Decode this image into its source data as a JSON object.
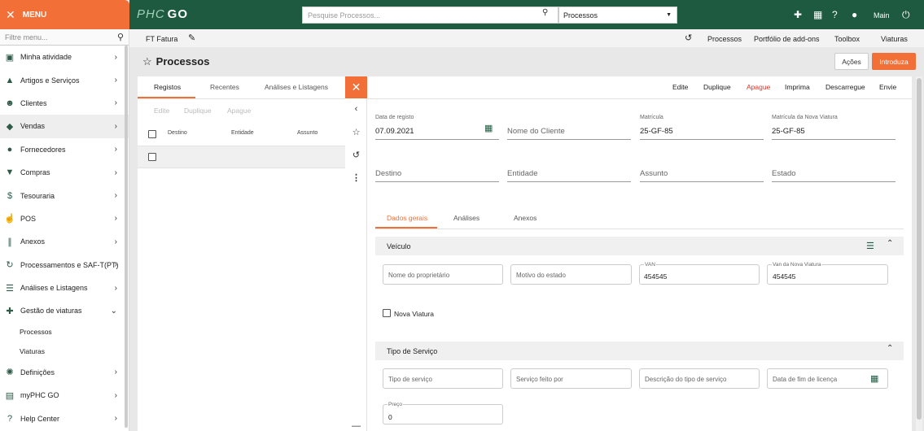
{
  "menu": {
    "title": "MENU",
    "filter_placeholder": "Filtre menu...",
    "items": [
      {
        "label": "Minha atividade",
        "icon": "person-board-icon"
      },
      {
        "label": "Artigos e Serviços",
        "icon": "shapes-icon"
      },
      {
        "label": "Clientes",
        "icon": "people-icon"
      },
      {
        "label": "Vendas",
        "icon": "tag-icon"
      },
      {
        "label": "Fornecedores",
        "icon": "person-icon"
      },
      {
        "label": "Compras",
        "icon": "basket-icon"
      },
      {
        "label": "Tesouraria",
        "icon": "dollar-icon"
      },
      {
        "label": "POS",
        "icon": "touch-icon"
      },
      {
        "label": "Anexos",
        "icon": "paperclip-icon"
      },
      {
        "label": "Processamentos e SAF-T(PT)",
        "icon": "sync-icon"
      },
      {
        "label": "Análises e Listagens",
        "icon": "list-icon"
      },
      {
        "label": "Gestão de viaturas",
        "icon": "puzzle-icon"
      }
    ],
    "subitems": [
      "Processos",
      "Viaturas"
    ],
    "items_after": [
      {
        "label": "Definições",
        "icon": "gear-icon"
      },
      {
        "label": "myPHC GO",
        "icon": "document-icon"
      },
      {
        "label": "Help Center",
        "icon": "help-icon"
      }
    ]
  },
  "topbar": {
    "logo_left": "PHC",
    "logo_right": "GO",
    "search_placeholder": "Pesquise Processos...",
    "search_scope": "Processos",
    "user_label": "Main"
  },
  "secbar": {
    "left_label": "FT Fatura",
    "links": [
      "Processos",
      "Portfólio de add-ons",
      "Toolbox",
      "Viaturas"
    ]
  },
  "page": {
    "title": "Processos",
    "btn_actions": "Ações",
    "btn_introduce": "Introduza"
  },
  "list": {
    "tabs": [
      "Registos",
      "Recentes",
      "Análises e Listagens"
    ],
    "actions": [
      "Edite",
      "Duplique",
      "Apague"
    ],
    "columns": [
      "Destino",
      "Entidade",
      "Assunto"
    ]
  },
  "form": {
    "actions": [
      "Edite",
      "Duplique",
      "Apague",
      "Imprima",
      "Descarregue",
      "Envie"
    ],
    "fields_row1": [
      {
        "label": "Data de registo",
        "value": "07.09.2021"
      },
      {
        "label": "",
        "value": "Nome do Cliente"
      },
      {
        "label": "Matrícula",
        "value": "25-GF-85"
      },
      {
        "label": "Matrícula da Nova Viatura",
        "value": "25-GF-85"
      }
    ],
    "fields_row2": [
      "Destino",
      "Entidade",
      "Assunto",
      "Estado"
    ],
    "tabs": [
      "Dados gerais",
      "Análises",
      "Anexos"
    ],
    "section_vehicle": {
      "title": "Veículo",
      "boxes": [
        {
          "label": "",
          "value": "Nome do proprietário"
        },
        {
          "label": "",
          "value": "Motivo do estado"
        },
        {
          "label": "VAN",
          "value": "454545"
        },
        {
          "label": "Van da Nova Viatura",
          "value": "454545"
        }
      ],
      "checkbox_label": "Nova Viatura"
    },
    "section_service": {
      "title": "Tipo de Serviço",
      "boxes": [
        "Tipo de serviço",
        "Serviço feito por",
        "Descrição do tipo de serviço",
        "Data de fim de licença"
      ],
      "price_label": "Preço",
      "price_value": "0"
    }
  },
  "colors": {
    "brand_green": "#1e5a40",
    "accent_orange": "#f36f38",
    "danger_red": "#d9362b"
  }
}
